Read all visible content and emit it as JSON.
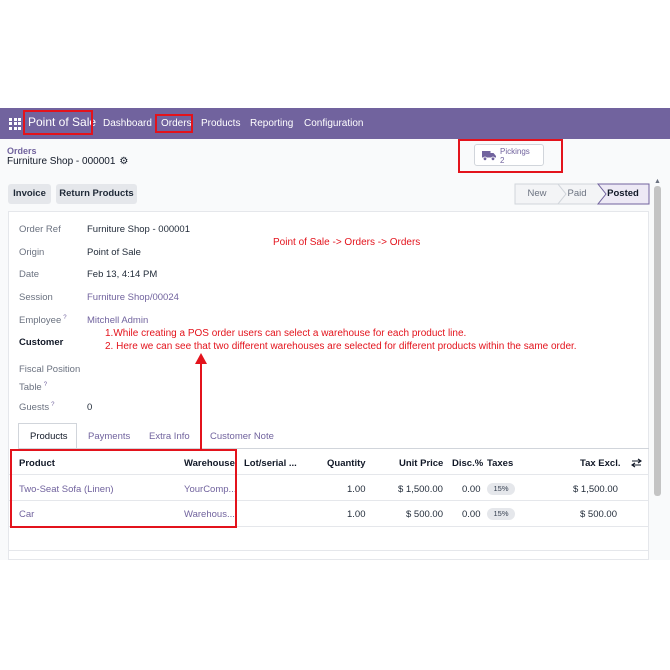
{
  "navbar": {
    "brand": "Point of Sale",
    "menu": [
      "Dashboard",
      "Orders",
      "Products",
      "Reporting",
      "Configuration"
    ]
  },
  "breadcrumb": {
    "parent": "Orders",
    "current": "Furniture Shop - 000001"
  },
  "smart_button": {
    "label": "Pickings",
    "count": "2"
  },
  "actions": {
    "invoice": "Invoice",
    "return_products": "Return Products"
  },
  "statusbar": [
    "New",
    "Paid",
    "Posted"
  ],
  "form": {
    "order_ref_label": "Order Ref",
    "order_ref": "Furniture Shop - 000001",
    "origin_label": "Origin",
    "origin": "Point of Sale",
    "date_label": "Date",
    "date": "Feb 13, 4:14 PM",
    "session_label": "Session",
    "session": "Furniture Shop/00024",
    "employee_label": "Employee",
    "employee": "Mitchell Admin",
    "customer_label": "Customer",
    "fiscal_position_label": "Fiscal Position",
    "table_label": "Table",
    "guests_label": "Guests",
    "guests": "0",
    "help_mark": "?"
  },
  "tabs": [
    "Products",
    "Payments",
    "Extra Info",
    "Customer Note"
  ],
  "table": {
    "headers": {
      "product": "Product",
      "warehouse": "Warehouse",
      "lot": "Lot/serial ...",
      "quantity": "Quantity",
      "unit_price": "Unit Price",
      "disc": "Disc.%",
      "taxes": "Taxes",
      "tax_excl": "Tax Excl."
    },
    "rows": [
      {
        "product": "Two-Seat Sofa (Linen)",
        "warehouse": "YourComp...",
        "quantity": "1.00",
        "unit_price": "$ 1,500.00",
        "disc": "0.00",
        "tax": "15%",
        "tax_excl": "$ 1,500.00"
      },
      {
        "product": "Car",
        "warehouse": "Warehous...",
        "quantity": "1.00",
        "unit_price": "$ 500.00",
        "disc": "0.00",
        "tax": "15%",
        "tax_excl": "$ 500.00"
      }
    ]
  },
  "annotations": {
    "path": "Point of Sale -> Orders -> Orders",
    "note1": "1.While creating a POS order users can select a warehouse for each product line.",
    "note2": "2. Here we can see that two different warehouses are selected for different products within the same order."
  },
  "colors": {
    "navbar": "#71639e",
    "link": "#71639e",
    "annotation": "#e3131c"
  },
  "icons": [
    "apps-grid-icon",
    "gear-icon",
    "truck-icon",
    "column-settings-icon"
  ]
}
